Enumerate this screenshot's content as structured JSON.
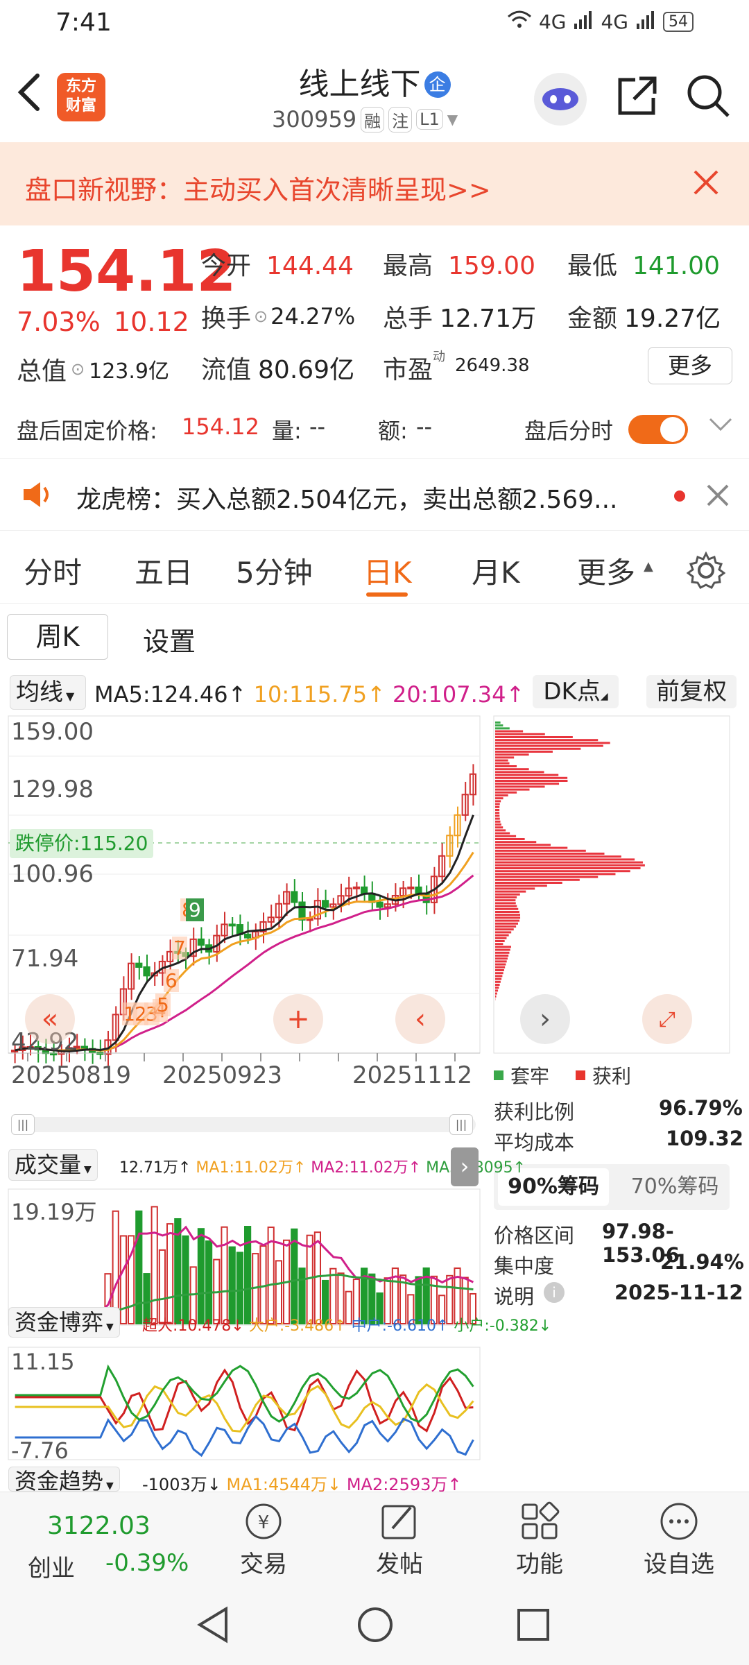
{
  "status": {
    "time": "7:41",
    "signal1": "4G",
    "signal2": "4G",
    "battery": "54"
  },
  "header": {
    "logo_line1": "东方",
    "logo_line2": "财富",
    "title": "线上线下",
    "badge": "企",
    "code": "300959",
    "tag_margin": "融",
    "tag_note": "注",
    "tag_level": "L1"
  },
  "banner": {
    "text": "盘口新视野：主动买入首次清晰呈现>>"
  },
  "quote": {
    "price": "154.12",
    "pct": "7.03%",
    "change": "10.12",
    "open_label": "今开",
    "open": "144.44",
    "high_label": "最高",
    "high": "159.00",
    "low_label": "最低",
    "low": "141.00",
    "turnover_label": "换手",
    "turnover": "24.27%",
    "volume_label": "总手",
    "volume": "12.71万",
    "amount_label": "金额",
    "amount": "19.27亿",
    "mktcap_label": "总值",
    "mktcap": "123.9亿",
    "float_label": "流值",
    "float": "80.69亿",
    "pe_label": "市盈",
    "pe_sup": "动",
    "pe": "2649.38",
    "more": "更多"
  },
  "afterhours": {
    "label": "盘后固定价格:",
    "price": "154.12",
    "vol_label": "量:",
    "vol": "--",
    "amt_label": "额:",
    "amt": "--",
    "toggle_label": "盘后分时",
    "toggle_on": true
  },
  "lhb": {
    "text": "龙虎榜：买入总额2.504亿元，卖出总额2.569..."
  },
  "tabs": [
    "分时",
    "五日",
    "5分钟",
    "日K",
    "月K",
    "更多"
  ],
  "active_tab": "日K",
  "subtabs": {
    "week": "周K",
    "settings": "设置"
  },
  "ma": {
    "selector": "均线",
    "ma5": "MA5:124.46↑",
    "ma10": "10:115.75↑",
    "ma20": "20:107.34↑",
    "dk": "DK点",
    "adj": "前复权",
    "ma5_color": "#222222",
    "ma10_color": "#f0a020",
    "ma20_color": "#d0208a"
  },
  "kline": {
    "y_labels": [
      "159.00",
      "129.98",
      "100.96",
      "71.94",
      "42.92"
    ],
    "x_labels": [
      "20250819",
      "20250923",
      "20251112"
    ],
    "limit_down": "跌停价:115.20",
    "markers": [
      "1",
      "2",
      "3",
      "4",
      "5",
      "6",
      "7",
      "8",
      "9"
    ]
  },
  "chips": {
    "legend_trapped": "套牢",
    "legend_profit": "获利",
    "profit_ratio_label": "获利比例",
    "profit_ratio": "96.79%",
    "avg_cost_label": "平均成本",
    "avg_cost": "109.32",
    "tab90": "90%筹码",
    "tab70": "70%筹码",
    "range_label": "价格区间",
    "range": "97.98-153.06",
    "conc_label": "集中度",
    "conc": "21.94%",
    "note_label": "说明",
    "note": "2025-11-12"
  },
  "volume": {
    "title": "成交量",
    "v": "12.71万↑",
    "ma1": "MA1:11.02万↑",
    "ma2": "MA2:11.02万↑",
    "ma3": "MA3:78095↑",
    "y_label": "19.19万"
  },
  "fund": {
    "title": "资金博弈",
    "super": "超大:10.478↓",
    "large": "大户:-3.486↑",
    "mid": "中户:-6.610↑",
    "small": "小户:-0.382↓",
    "y_top": "11.15",
    "y_bot": "-7.76"
  },
  "trend": {
    "title": "资金趋势",
    "v": "-1003万↓",
    "ma1": "MA1:4544万↓",
    "ma2": "MA2:2593万↑"
  },
  "navbar": {
    "index_value": "3122.03",
    "index_name": "创业",
    "index_pct": "-0.39%",
    "trade": "交易",
    "post": "发帖",
    "func": "功能",
    "watch": "设自选"
  }
}
